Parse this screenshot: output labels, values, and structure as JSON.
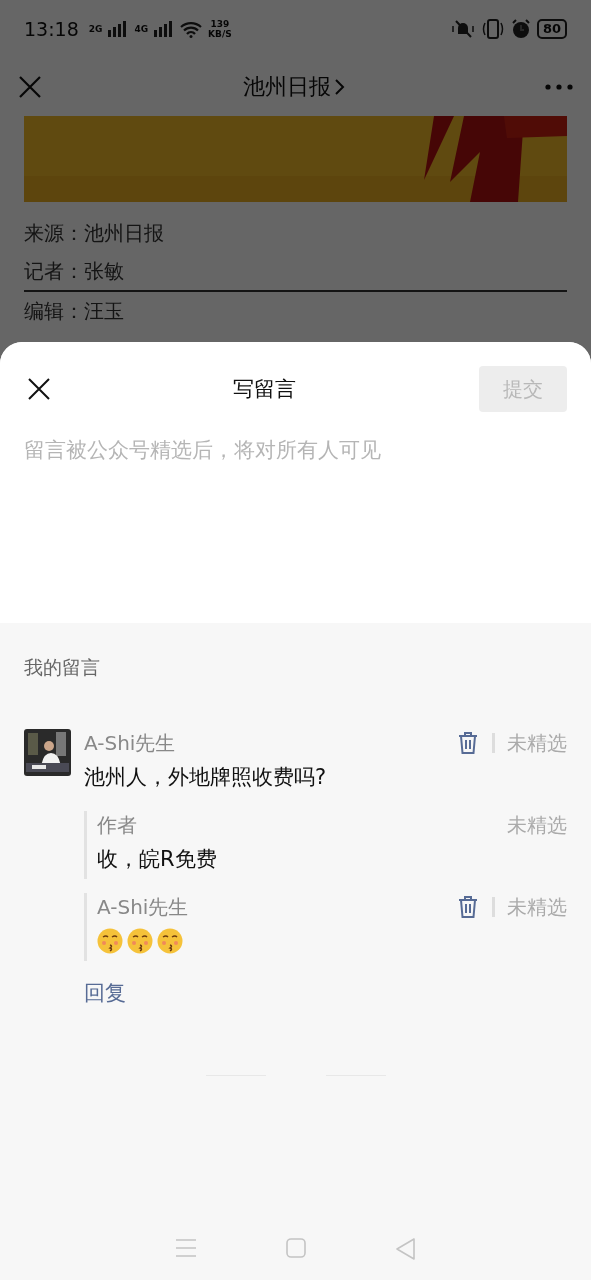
{
  "status_bar": {
    "time": "13:18",
    "network_1": "2G",
    "network_2": "4G",
    "speed": "139",
    "speed_unit": "KB/S",
    "battery": "80"
  },
  "nav": {
    "title": "池州日报"
  },
  "article": {
    "lines": [
      {
        "text": "来源：池州日报",
        "rule_below": false
      },
      {
        "text": "记者：张敏",
        "rule_below": true
      },
      {
        "text": "编辑：汪玉",
        "rule_below": false
      }
    ]
  },
  "sheet": {
    "title": "写留言",
    "submit": {
      "label": "提交",
      "disabled": true
    },
    "input": {
      "placeholder": "留言被公众号精选后，将对所有人可见"
    },
    "section_title": "我的留言",
    "comment": {
      "author": "A-Shi先生",
      "deletable": true,
      "status": "未精选",
      "text": "池州人，外地牌照收费吗?",
      "replies": [
        {
          "kind": "text",
          "author": "作者",
          "deletable": false,
          "status": "未精选",
          "text": "收，皖R免费"
        },
        {
          "kind": "emoji",
          "author": "A-Shi先生",
          "deletable": true,
          "status": "未精选",
          "emojis": [
            {
              "kind": "kissing-face"
            },
            {
              "kind": "kissing-face"
            },
            {
              "kind": "kissing-face"
            }
          ]
        }
      ],
      "reply_link": "回复"
    }
  }
}
